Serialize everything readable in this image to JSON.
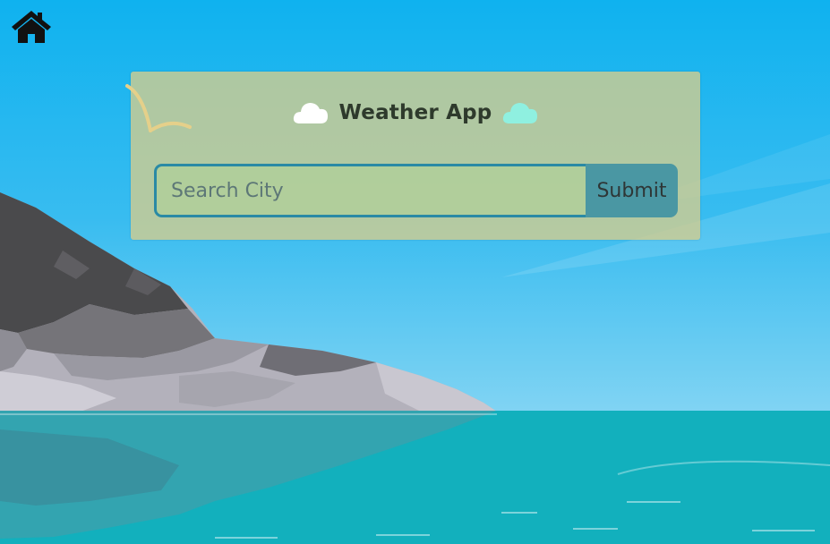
{
  "app": {
    "title": "Weather App"
  },
  "nav": {
    "home_icon": "home-icon"
  },
  "search": {
    "placeholder": "Search City",
    "value": "",
    "submit_label": "Submit"
  },
  "icons": {
    "left_cloud": "cloud-icon",
    "right_cloud": "cloud-icon"
  },
  "colors": {
    "sky_top": "#0fb2ef",
    "sea": "#12b0bd",
    "card_bg": "#d7cd8c",
    "input_border": "#2a8aa5",
    "submit_bg": "#4a97a3",
    "left_cloud": "#ffffff",
    "right_cloud": "#8ff0e0"
  }
}
